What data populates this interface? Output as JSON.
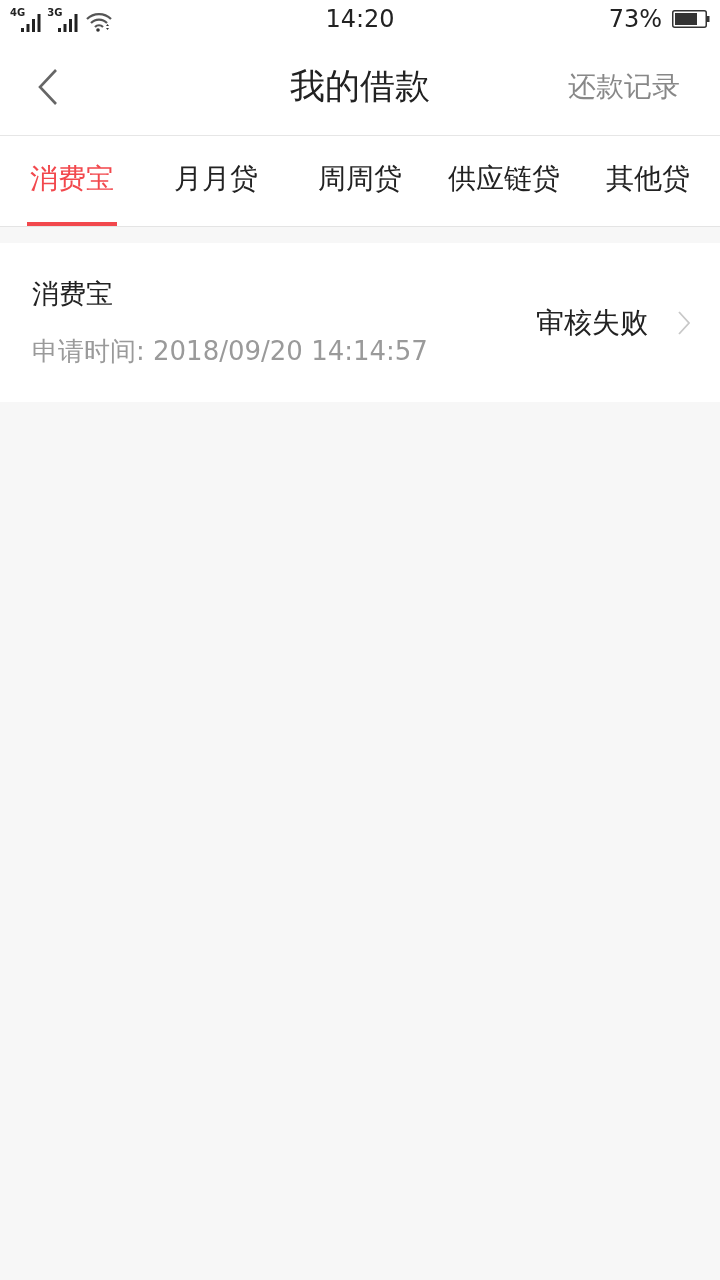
{
  "status_bar": {
    "networks": [
      {
        "label": "4G"
      },
      {
        "label": "3G"
      }
    ],
    "time": "14:20",
    "battery": "73%"
  },
  "header": {
    "title": "我的借款",
    "action": "还款记录"
  },
  "tabs": [
    {
      "label": "消费宝",
      "selected": true
    },
    {
      "label": "月月贷",
      "selected": false
    },
    {
      "label": "周周贷",
      "selected": false
    },
    {
      "label": "供应链贷",
      "selected": false
    },
    {
      "label": "其他贷",
      "selected": false
    }
  ],
  "loans": [
    {
      "name": "消费宝",
      "applied": "申请时间:  2018/09/20 14:14:57",
      "status": "审核失败"
    }
  ]
}
